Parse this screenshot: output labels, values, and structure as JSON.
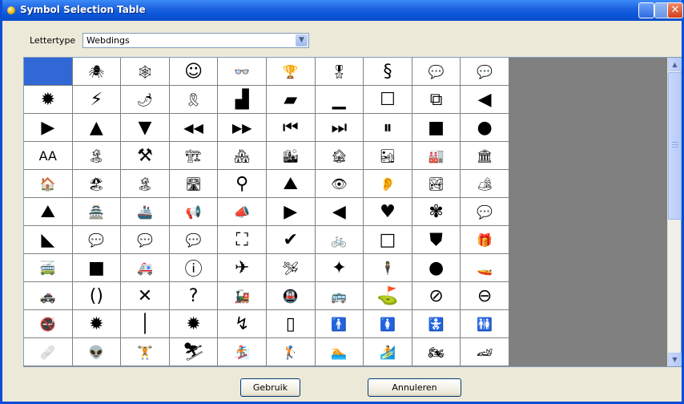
{
  "window": {
    "title": "Symbol Selection Table"
  },
  "font": {
    "label": "Lettertype",
    "selected": "Webdings"
  },
  "symbols": [
    [
      "",
      "🕷",
      "🕸",
      "☺",
      "👓",
      "🏆",
      "🎖",
      "§",
      "💬",
      "💬"
    ],
    [
      "✹",
      "⚡",
      "🌶",
      "🎗",
      "▟",
      "▰",
      "▁",
      "☐",
      "⧉",
      "◀"
    ],
    [
      "▶",
      "▲",
      "▼",
      "◀◀",
      "▶▶",
      "⏮",
      "⏭",
      "⏸",
      "■",
      "●"
    ],
    [
      "AA",
      "🏝",
      "⚒",
      "🏗",
      "🏘",
      "🏙",
      "🏚",
      "🏜",
      "🏭",
      "🏛"
    ],
    [
      "🏠",
      "🏖",
      "🏝",
      "🛣",
      "⚲",
      "⛰",
      "👁",
      "👂",
      "🏞",
      "🏕"
    ],
    [
      "⛰",
      "🏯",
      "🚢",
      "📢",
      "📣",
      "▶",
      "◀",
      "♥",
      "✾",
      "💬"
    ],
    [
      "◣",
      "💬",
      "💬",
      "💬",
      "⛶",
      "✔",
      "🚲",
      "□",
      "⛊",
      "🎁"
    ],
    [
      "🚎",
      "■",
      "🚑",
      "ⓘ",
      "✈",
      "🛩",
      "✦",
      "🕴",
      "●",
      "🚤"
    ],
    [
      "🚓",
      "()",
      "✕",
      "?",
      "🚂",
      "🚇",
      "🚌",
      "⛳",
      "⊘",
      "⊖"
    ],
    [
      "🚭",
      "✹",
      "│",
      "✹",
      "↯",
      "▯",
      "🚹",
      "🚺",
      "🚼",
      "🚻"
    ],
    [
      "🩹",
      "👽",
      "🏋",
      "⛷",
      "🏂",
      "🏌",
      "🏊",
      "🏄",
      "🏍",
      "🏎"
    ]
  ],
  "buttons": {
    "use": "Gebruik",
    "cancel": "Annuleren"
  },
  "colors": {
    "selection": "#3168D5",
    "titlebar": "#0A55D8",
    "panel_bg": "#808080"
  }
}
